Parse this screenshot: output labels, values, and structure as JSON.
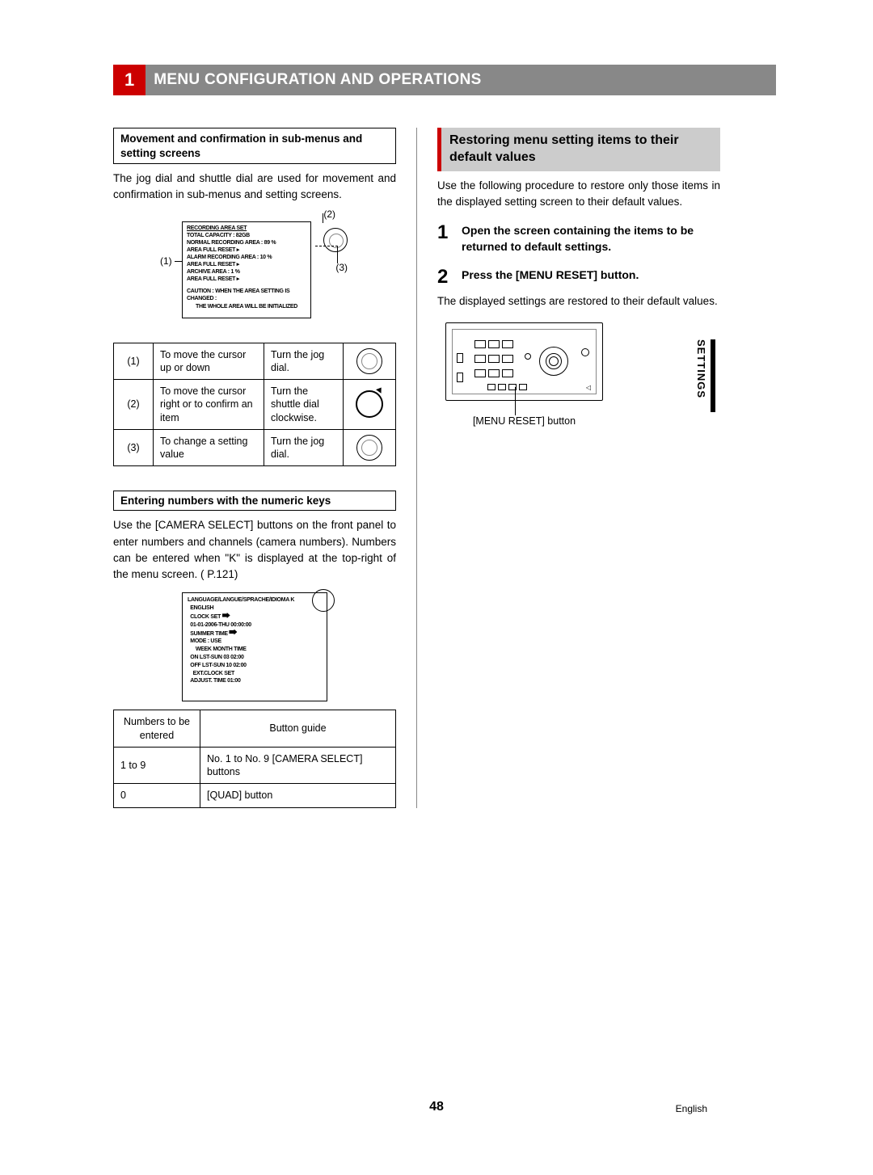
{
  "header": {
    "num": "1",
    "title": "MENU CONFIGURATION AND OPERATIONS"
  },
  "tab": "SETTINGS",
  "left": {
    "box1_title": "Movement and confirmation in sub-menus and setting screens",
    "box1_text": "The jog dial and shuttle dial are used for movement and confirmation in sub-menus and setting screens.",
    "callouts": {
      "n1": "(1)",
      "n2": "(2)",
      "n3": "(3)"
    },
    "screen1": {
      "l1": "RECORDING AREA SET",
      "l2": "TOTAL CAPACITY        : 82GB",
      "l3": "NORMAL RECORDING AREA   : 89 %",
      "l4": "AREA FULL RESET  ▸",
      "l5": "ALARM RECORDING AREA    : 10 %",
      "l6": "AREA FULL RESET  ▸",
      "l7": "ARCHIVE AREA        : 1 %",
      "l8": "AREA FULL RESET  ▸",
      "l9": "CAUTION : WHEN THE AREA SETTING IS CHANGED :",
      "l10": "THE WHOLE AREA WILL BE INITIALIZED"
    },
    "table1": [
      {
        "n": "(1)",
        "desc": "To move the cursor up or down",
        "action": "Turn the jog dial.",
        "icon": "jog"
      },
      {
        "n": "(2)",
        "desc": "To move the cursor right or to confirm an item",
        "action": "Turn the shuttle dial clockwise.",
        "icon": "shuttle"
      },
      {
        "n": "(3)",
        "desc": "To change a setting value",
        "action": "Turn the jog dial.",
        "icon": "jog"
      }
    ],
    "box2_title": "Entering numbers with the numeric keys",
    "box2_text": "Use the [CAMERA SELECT] buttons on the front panel to enter numbers and channels (camera numbers). Numbers can be entered when \"K\" is displayed at the top-right of the menu screen. (     P.121)",
    "screen2": {
      "l1": "LANGUAGE/LANGUE/SPRACHE/IDIOMA     K",
      "l2": "ENGLISH",
      "l3": "CLOCK SET",
      "l4": "01-01-2006-THU 00:00:00",
      "l5": "SUMMER TIME",
      "l6": "MODE  :  USE",
      "l7": "WEEK  MONTH  TIME",
      "l8": "ON  LST-SUN   03   02:00",
      "l9": "OFF LST-SUN   10   02:00",
      "l10": "EXT.CLOCK SET",
      "l11": "ADJUST. TIME    01:00"
    },
    "table2": {
      "h1": "Numbers to be entered",
      "h2": "Button guide",
      "r1c1": "1 to 9",
      "r1c2": "No. 1 to No. 9 [CAMERA SELECT] buttons",
      "r2c1": "0",
      "r2c2": "[QUAD] button"
    }
  },
  "right": {
    "section_title": "Restoring menu setting items to their default values",
    "intro": "Use the following procedure to restore only those items in the displayed setting screen to their default values.",
    "step1": {
      "n": "1",
      "text": "Open the screen containing the items to be returned to default settings."
    },
    "step2": {
      "n": "2",
      "text": "Press the [MENU RESET] button."
    },
    "result": "The displayed settings are restored to their default values.",
    "caption": "[MENU RESET] button"
  },
  "footer": {
    "page": "48",
    "lang": "English"
  }
}
